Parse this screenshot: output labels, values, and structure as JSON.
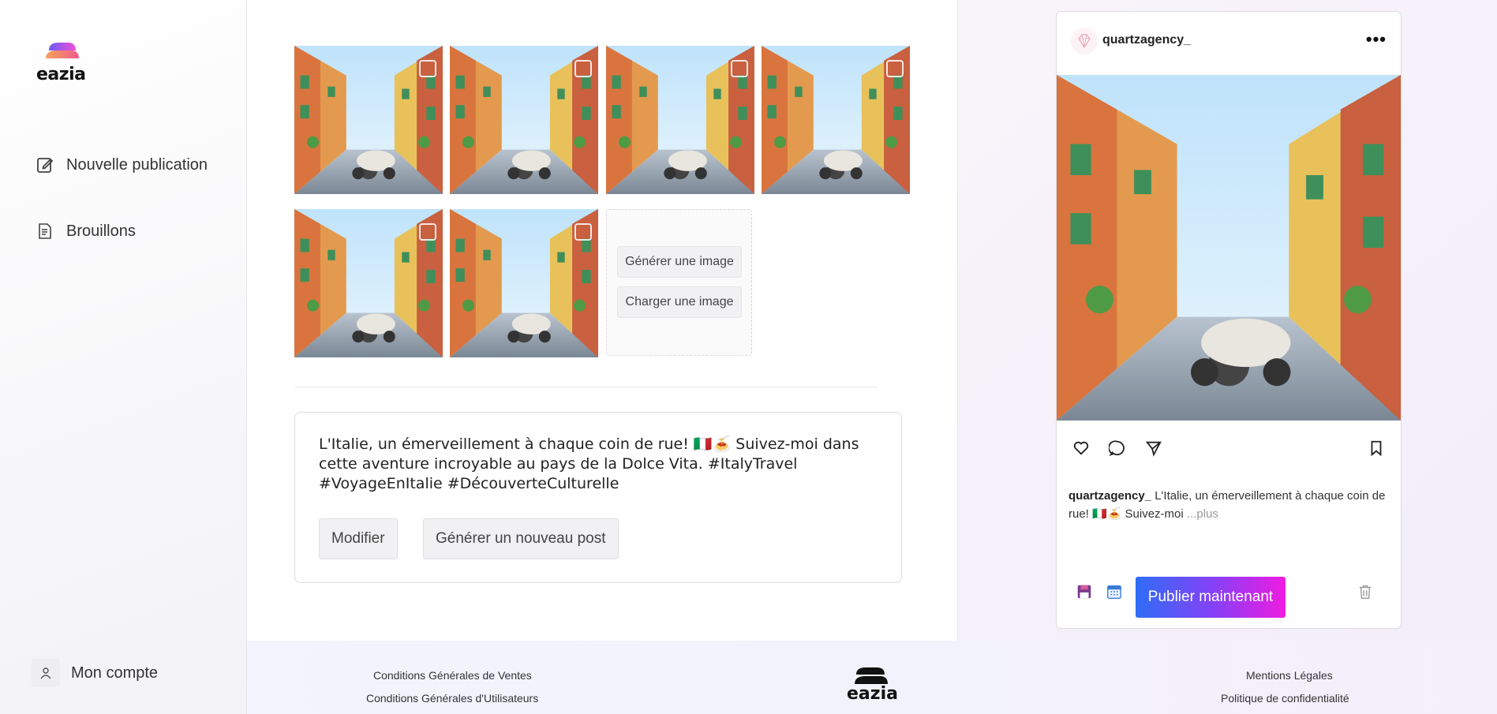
{
  "app": {
    "logo_text": "eazia"
  },
  "sidebar": {
    "items": [
      {
        "label": "Nouvelle publication",
        "icon": "edit-icon"
      },
      {
        "label": "Brouillons",
        "icon": "document-icon"
      }
    ],
    "account": {
      "label": "Mon compte",
      "icon": "user-icon"
    }
  },
  "gallery": {
    "image_count": 6,
    "generate_label": "Générer une image",
    "upload_label": "Charger une image"
  },
  "post": {
    "text": "L'Italie, un émerveillement à chaque coin de rue! 🇮🇹🍝 Suivez-moi dans cette aventure incroyable au pays de la Dolce Vita. #ItalyTravel #VoyageEnItalie #DécouverteCulturelle",
    "modify_label": "Modifier",
    "regenerate_label": "Générer un nouveau post"
  },
  "preview": {
    "username": "quartzagency_",
    "more_icon": "more-dots-icon",
    "caption": "L'Italie, un émerveillement à chaque coin de rue! 🇮🇹🍝 Suivez-moi",
    "caption_more": "...plus",
    "publish_label": "Publier maintenant",
    "accent_gradient": [
      "#2f6df6",
      "#8b3ef5",
      "#f01ce0"
    ]
  },
  "footer": {
    "cgv": "Conditions Générales de Ventes",
    "cgu": "Conditions Générales d'Utilisateurs",
    "mentions": "Mentions Légales",
    "privacy": "Politique de confidentialité",
    "logo_text": "eazia"
  }
}
